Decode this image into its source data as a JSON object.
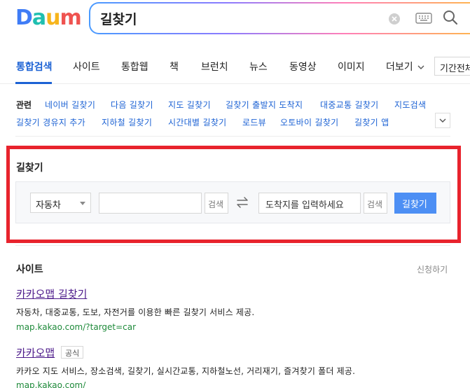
{
  "logo": {
    "letters": [
      {
        "char": "D",
        "color": "#3f7cf6"
      },
      {
        "char": "a",
        "color": "#1fbfb0"
      },
      {
        "char": "u",
        "color": "#f7b51c"
      },
      {
        "char": "m",
        "color": "#ef5350"
      }
    ]
  },
  "search": {
    "query": "길찾기"
  },
  "tabs": [
    {
      "label": "통합검색",
      "active": true
    },
    {
      "label": "사이트"
    },
    {
      "label": "통합웹"
    },
    {
      "label": "책"
    },
    {
      "label": "브런치"
    },
    {
      "label": "뉴스"
    },
    {
      "label": "동영상"
    },
    {
      "label": "이미지"
    },
    {
      "label": "더보기"
    }
  ],
  "period_select": "기간전체",
  "related": {
    "label": "관련",
    "items": [
      "네이버 길찾기",
      "다음 길찾기",
      "지도 길찾기",
      "길찾기 출발지 도착지",
      "대중교통 길찾기",
      "지도검색",
      "길찾기 경유지 추가",
      "지하철 길찾기",
      "시간대별 길찾기",
      "로드뷰",
      "오토바이 길찾기",
      "길찾기 앱"
    ]
  },
  "route": {
    "title": "길찾기",
    "mode": "자동차",
    "start_value": "",
    "search_label": "검색",
    "dest_placeholder": "도착지를 입력하세요",
    "go_label": "길찾기"
  },
  "site": {
    "title": "사이트",
    "apply": "신청하기",
    "results": [
      {
        "title": "카카오맵 길찾기",
        "desc": "자동차, 대중교통, 도보, 자전거를 이용한 빠른 길찾기 서비스 제공.",
        "url": "map.kakao.com/?target=car"
      },
      {
        "title": "카카오맵",
        "badge": "공식",
        "desc": "카카오 지도 서비스, 장소검색, 길찾기, 실시간교통, 지하철노선, 거리재기, 즐겨찾기 폴더 제공.",
        "url": "map.kakao.com/"
      }
    ]
  },
  "colors": {
    "accent": "#1c62d4",
    "highlight": "#e8232d",
    "button": "#4d8ff4",
    "url": "#1e8a3a",
    "visited": "#4c1a8a"
  }
}
